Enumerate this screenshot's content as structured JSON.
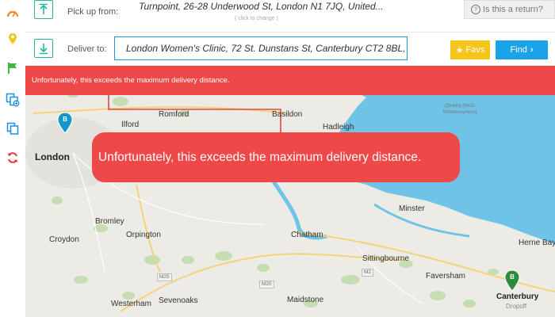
{
  "sidebar": {
    "icons": [
      "speedometer-icon",
      "location-pin-icon",
      "flag-icon",
      "add-copy-icon",
      "copy-icon",
      "refresh-icon"
    ],
    "colors": [
      "#f08a24",
      "#f5c518",
      "#43b649",
      "#1a8fe3",
      "#1a8fe3",
      "#e53935"
    ]
  },
  "pickup": {
    "label": "Pick up from:",
    "value": "Turnpoint, 26-28 Underwood St, London N1 7JQ, United...",
    "hint": "( click to change )",
    "return_label": "Is this a return?"
  },
  "deliver": {
    "label": "Deliver to:",
    "value": "London Women's Clinic, 72 St. Dunstans St, Canterbury CT2 8BL,"
  },
  "buttons": {
    "favs": "Favs",
    "find": "Find"
  },
  "error": {
    "banner": "Unfortunately, this exceeds the maximum delivery distance.",
    "toast": "Unfortunately, this exceeds the maximum delivery distance."
  },
  "map": {
    "places": {
      "london": "London",
      "romford": "Romford",
      "ilford": "Ilford",
      "basildon": "Basildon",
      "hadleigh": "Hadleigh",
      "shoeburyness": "Qinetiq (MoD\nShoeburyness)",
      "bromley": "Bromley",
      "croydon": "Croydon",
      "orpington": "Orpington",
      "chatham": "Chatham",
      "minster": "Minster",
      "sittingbourne": "Sittingbourne",
      "faversham": "Faversham",
      "herne_bay": "Herne Bay",
      "canterbury": "Canterbury",
      "westerham": "Westerham",
      "sevenoaks": "Sevenoaks",
      "maidstone": "Maidstone"
    },
    "roads": {
      "m25": "M25",
      "m20": "M20",
      "m2": "M2"
    },
    "marker_a": "B",
    "marker_b": "B",
    "dropoff": "Dropoff",
    "colors": {
      "sea": "#6fc3e6",
      "land": "#ecebe5",
      "marker_pickup": "#1596c8",
      "marker_dropoff": "#2e8b3e",
      "route": "#e04848"
    }
  }
}
